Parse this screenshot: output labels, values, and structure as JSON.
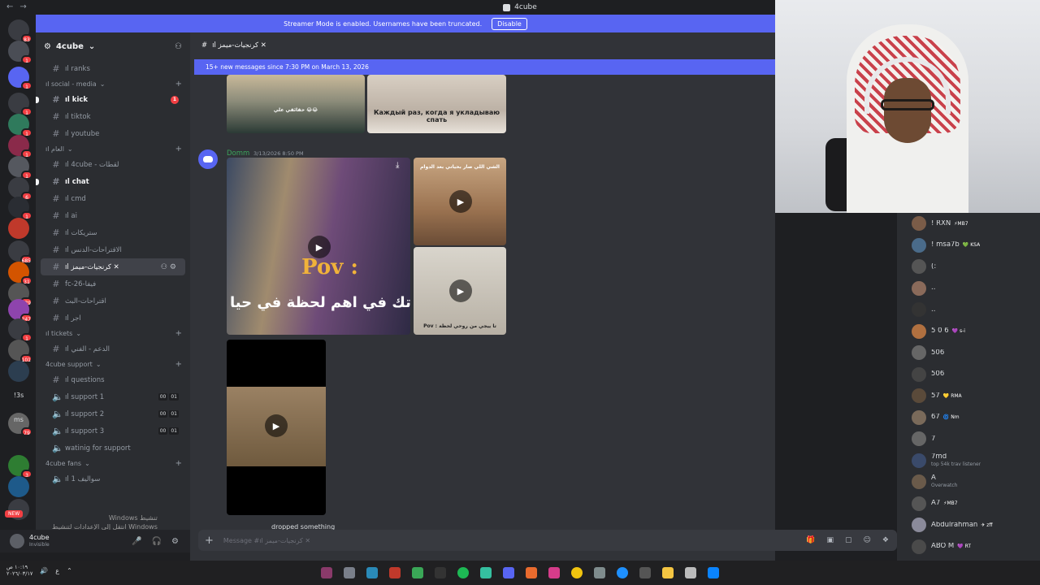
{
  "window": {
    "title": "4cube"
  },
  "streamer_banner": {
    "text": "Streamer Mode is enabled. Usernames have been truncated.",
    "button": "Disable"
  },
  "rail": {
    "badges": [
      "83",
      "1",
      "1",
      "1",
      "1",
      "1",
      "1",
      "6",
      "1",
      "685",
      "31",
      "679",
      "247",
      "1",
      "101",
      "16",
      "79",
      "3"
    ],
    "texts": [
      "!3s",
      "ms"
    ],
    "new_label": "NEW"
  },
  "sidebar": {
    "guild_name": "4cube",
    "top_channel": "ıl ranks",
    "categories": [
      {
        "name": "ıl social - media",
        "channels": [
          {
            "label": "ıl kick",
            "unread": true,
            "mention": "1"
          },
          {
            "label": "ıl tiktok"
          },
          {
            "label": "ıl youtube"
          }
        ]
      },
      {
        "name": "ıl العام",
        "channels": [
          {
            "label": "ıl 4cube - لقطات"
          },
          {
            "label": "ıl chat",
            "unread": true
          },
          {
            "label": "ıl cmd"
          },
          {
            "label": "ıl ai"
          },
          {
            "label": "ıl ستريكات"
          },
          {
            "label": "ıl الاقتراحات-الدنس"
          },
          {
            "label": "ıl كرنجيات-ميمز ✕",
            "active": true
          },
          {
            "label": "fc-26-فيفا"
          },
          {
            "label": "اقتراحات-البث"
          },
          {
            "label": "ıl اجر"
          }
        ]
      },
      {
        "name": "ıl tickets",
        "channels": [
          {
            "label": "ıl الدعم - الفني"
          }
        ]
      },
      {
        "name": "4cube support",
        "channels": [
          {
            "label": "ıl questions"
          },
          {
            "label": "ıl support 1",
            "voice": true,
            "counts": [
              "00",
              "01"
            ]
          },
          {
            "label": "ıl support 2",
            "voice": true,
            "counts": [
              "00",
              "01"
            ]
          },
          {
            "label": "ıl support 3",
            "voice": true,
            "counts": [
              "00",
              "01"
            ]
          },
          {
            "label": "watinig for support",
            "voice": true
          }
        ]
      },
      {
        "name": "4cube fans",
        "channels": [
          {
            "label": "ıl سواليف 1",
            "voice": true
          }
        ]
      }
    ]
  },
  "watermark": {
    "line1": "Windows تنشيط",
    "line2": "انتقل إلى الإعدادات لتنشيط Windows"
  },
  "user_panel": {
    "name": "4cube",
    "status": "Invisible"
  },
  "chat": {
    "channel_name": "ıl كرنجيات-ميمز ✕",
    "new_messages": "15+ new messages since 7:30 PM on March 13, 2026",
    "message": {
      "author": "Domm",
      "timestamp": "3/13/2026 8:50 PM",
      "top_image_caption_left": "حقائقي علي 😂😂",
      "top_image_caption_right": "Каждый раз, когда я укладываю спать",
      "pov_text": "Pov :",
      "arabic_caption": "تك في اهم لحظة في حيا",
      "desert_caption": "الشي اللي صار بحياتي بعد الدوام",
      "room_caption": "Pov : تا ييجي من روحي لحظة",
      "cutoff_text": "dropped something"
    },
    "composer_placeholder": "Message #ıl كرنجيات-ميمز ✕"
  },
  "members": [
    {
      "name": "! RXN",
      "tag": "⚡MB7"
    },
    {
      "name": "! msa7b",
      "tag": "💚 KSA"
    },
    {
      "name": "(:",
      "tag": ""
    },
    {
      "name": "..",
      "tag": ""
    },
    {
      "name": "..",
      "tag": ""
    },
    {
      "name": "5 0 6",
      "tag": "💜 s-i"
    },
    {
      "name": "506",
      "tag": ""
    },
    {
      "name": "506",
      "tag": ""
    },
    {
      "name": "57",
      "tag": "💛 RMA"
    },
    {
      "name": "67",
      "tag": "🌀 Nm"
    },
    {
      "name": "7",
      "tag": ""
    },
    {
      "name": "7md",
      "tag": "",
      "sub": "top 54k trav listener"
    },
    {
      "name": "A",
      "tag": "",
      "sub": "Overwatch"
    },
    {
      "name": "A7",
      "tag": "⚡MB7"
    },
    {
      "name": "Abdulrahman",
      "tag": "✈ zff"
    },
    {
      "name": "ABO M",
      "tag": "💜 RT"
    }
  ],
  "taskbar": {
    "clock_time": "١٠:١٩ ص",
    "clock_date": "٢٠٢٦/٠٣/١٧",
    "lang": "ع"
  },
  "colors": {
    "blurple": "#5865f2",
    "bg": "#313338",
    "sidebar": "#2b2d31",
    "rail": "#1e1f22",
    "red": "#f23f43"
  }
}
